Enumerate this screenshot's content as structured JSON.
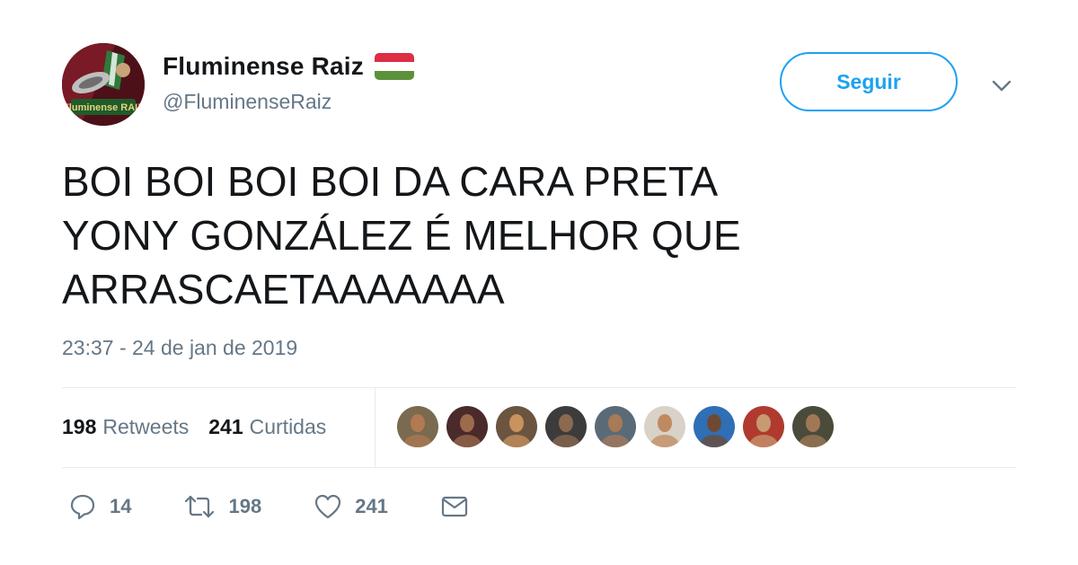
{
  "header": {
    "display_name": "Fluminense Raiz",
    "handle": "@FluminenseRaiz",
    "follow_label": "Seguir",
    "avatar_text": "Fluminense RAIZ",
    "flag_colors": [
      "#dd2e44",
      "#ffffff",
      "#5c913b"
    ]
  },
  "tweet": {
    "lines": [
      "BOI BOI BOI BOI DA CARA PRETA",
      "YONY GONZÁLEZ É MELHOR QUE",
      "ARRASCAETAAAAAAA"
    ],
    "timestamp": "23:37 - 24 de jan de 2019"
  },
  "stats": {
    "retweets_count": "198",
    "retweets_label": "Retweets",
    "likes_count": "241",
    "likes_label": "Curtidas"
  },
  "liker_avatars": [
    {
      "bg": "#7a6a4f",
      "skin": "#b07a52"
    },
    {
      "bg": "#4a2a2a",
      "skin": "#9c6b4c"
    },
    {
      "bg": "#6b5440",
      "skin": "#c9935e"
    },
    {
      "bg": "#3c3c3c",
      "skin": "#8c6a50"
    },
    {
      "bg": "#5a6b77",
      "skin": "#a77a58"
    },
    {
      "bg": "#d8d2c8",
      "skin": "#c08a60"
    },
    {
      "bg": "#2f6fb5",
      "skin": "#6e4a34"
    },
    {
      "bg": "#b03a2e",
      "skin": "#c79a72"
    },
    {
      "bg": "#4b4b3b",
      "skin": "#a07858"
    }
  ],
  "actions": {
    "reply_count": "14",
    "retweet_count": "198",
    "like_count": "241"
  },
  "colors": {
    "accent": "#1da1f2",
    "muted": "#657786",
    "text": "#14171a",
    "divider": "#e6ecf0"
  },
  "icons": {
    "reply": "reply-icon",
    "retweet": "retweet-icon",
    "like": "heart-icon",
    "dm": "envelope-icon",
    "more": "chevron-down-icon"
  }
}
